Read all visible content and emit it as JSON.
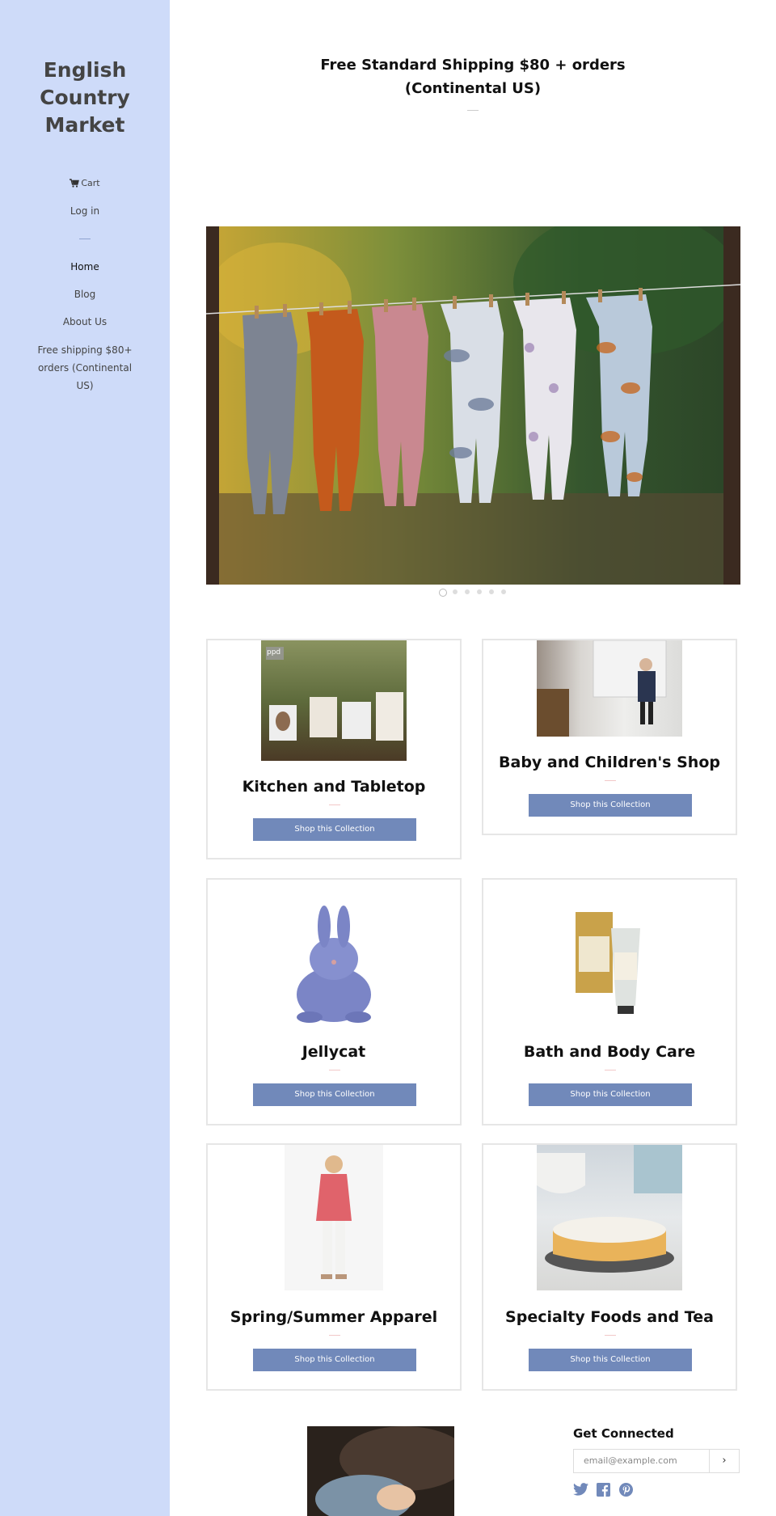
{
  "sidebar": {
    "site_title": "English Country Market",
    "cart_label": "Cart",
    "login_label": "Log in",
    "nav": {
      "home": "Home",
      "blog": "Blog",
      "about": "About Us",
      "shipping": "Free shipping $80+ orders (Continental US)"
    }
  },
  "main": {
    "headline": "Free Standard Shipping $80 + orders (Continental US)",
    "slideshow": {
      "slide_count": 6,
      "active_index": 0
    },
    "collections": [
      {
        "title": "Kitchen and Tabletop",
        "button": "Shop this Collection",
        "badge": "ppd"
      },
      {
        "title": "Baby and Children's Shop",
        "button": "Shop this Collection"
      },
      {
        "title": "Jellycat",
        "button": "Shop this Collection"
      },
      {
        "title": "Bath and Body Care",
        "button": "Shop this Collection"
      },
      {
        "title": "Spring/Summer Apparel",
        "button": "Shop this Collection"
      },
      {
        "title": "Specialty Foods and Tea",
        "button": "Shop this Collection"
      }
    ]
  },
  "footer": {
    "get_connected": "Get Connected",
    "email_placeholder": "email@example.com",
    "submit_glyph": "›",
    "social": [
      "twitter-icon",
      "facebook-icon",
      "pinterest-icon"
    ]
  },
  "colors": {
    "sidebar_bg": "#cedbf9",
    "button_bg": "#7189ba",
    "social_icon": "#7189ba"
  }
}
